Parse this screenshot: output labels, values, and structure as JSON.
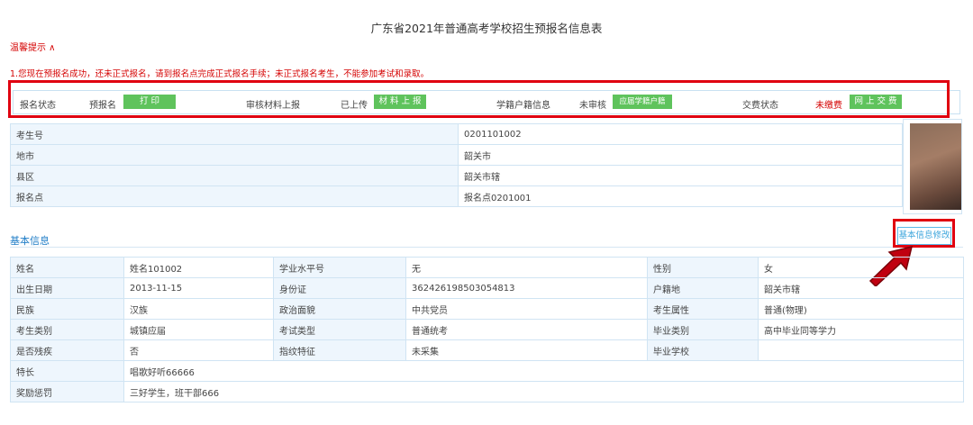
{
  "page": {
    "title": "广东省2021年普通高考学校招生预报名信息表",
    "tip_toggle": "温馨提示 ∧",
    "tip_text": "1.您现在预报名成功，还未正式报名，请到报名点完成正式报名手续；未正式报名考生，不能参加考试和录取。"
  },
  "status": {
    "signup_state_label": "报名状态",
    "signup_state_value": "预报名",
    "print_button": "打 印",
    "materials_label": "审核材料上报",
    "materials_value": "已上传",
    "materials_button": "材 料 上 报",
    "household_label": "学籍户籍信息",
    "household_value": "未审核",
    "household_button": "应届学籍户籍",
    "fee_label": "交费状态",
    "fee_value": "未缴费",
    "fee_button": "网 上 交 费"
  },
  "top_info": [
    {
      "label": "考生号",
      "value": "0201101002"
    },
    {
      "label": "地市",
      "value": "韶关市"
    },
    {
      "label": "县区",
      "value": "韶关市辖"
    },
    {
      "label": "报名点",
      "value": "报名点0201001"
    }
  ],
  "basic": {
    "section_title": "基本信息",
    "edit_button": "基本信息修改",
    "rows": [
      [
        "姓名",
        "姓名101002",
        "学业水平号",
        "无",
        "性别",
        "女"
      ],
      [
        "出生日期",
        "2013-11-15",
        "身份证",
        "362426198503054813",
        "户籍地",
        "韶关市辖"
      ],
      [
        "民族",
        "汉族",
        "政治面貌",
        "中共党员",
        "考生属性",
        "普通(物理)"
      ],
      [
        "考生类别",
        "城镇应届",
        "考试类型",
        "普通统考",
        "毕业类别",
        "高中毕业同等学力"
      ],
      [
        "是否残疾",
        "否",
        "指纹特征",
        "未采集",
        "毕业学校",
        ""
      ]
    ],
    "specialty_label": "特长",
    "specialty_value": "唱歌好听66666",
    "awards_label": "奖励惩罚",
    "awards_value": "三好学生，班干部666"
  },
  "colors": {
    "accent_red": "#e00010",
    "green_button": "#5fc35c",
    "label_bg": "#eef6fd",
    "link_blue": "#1f7dc7"
  }
}
